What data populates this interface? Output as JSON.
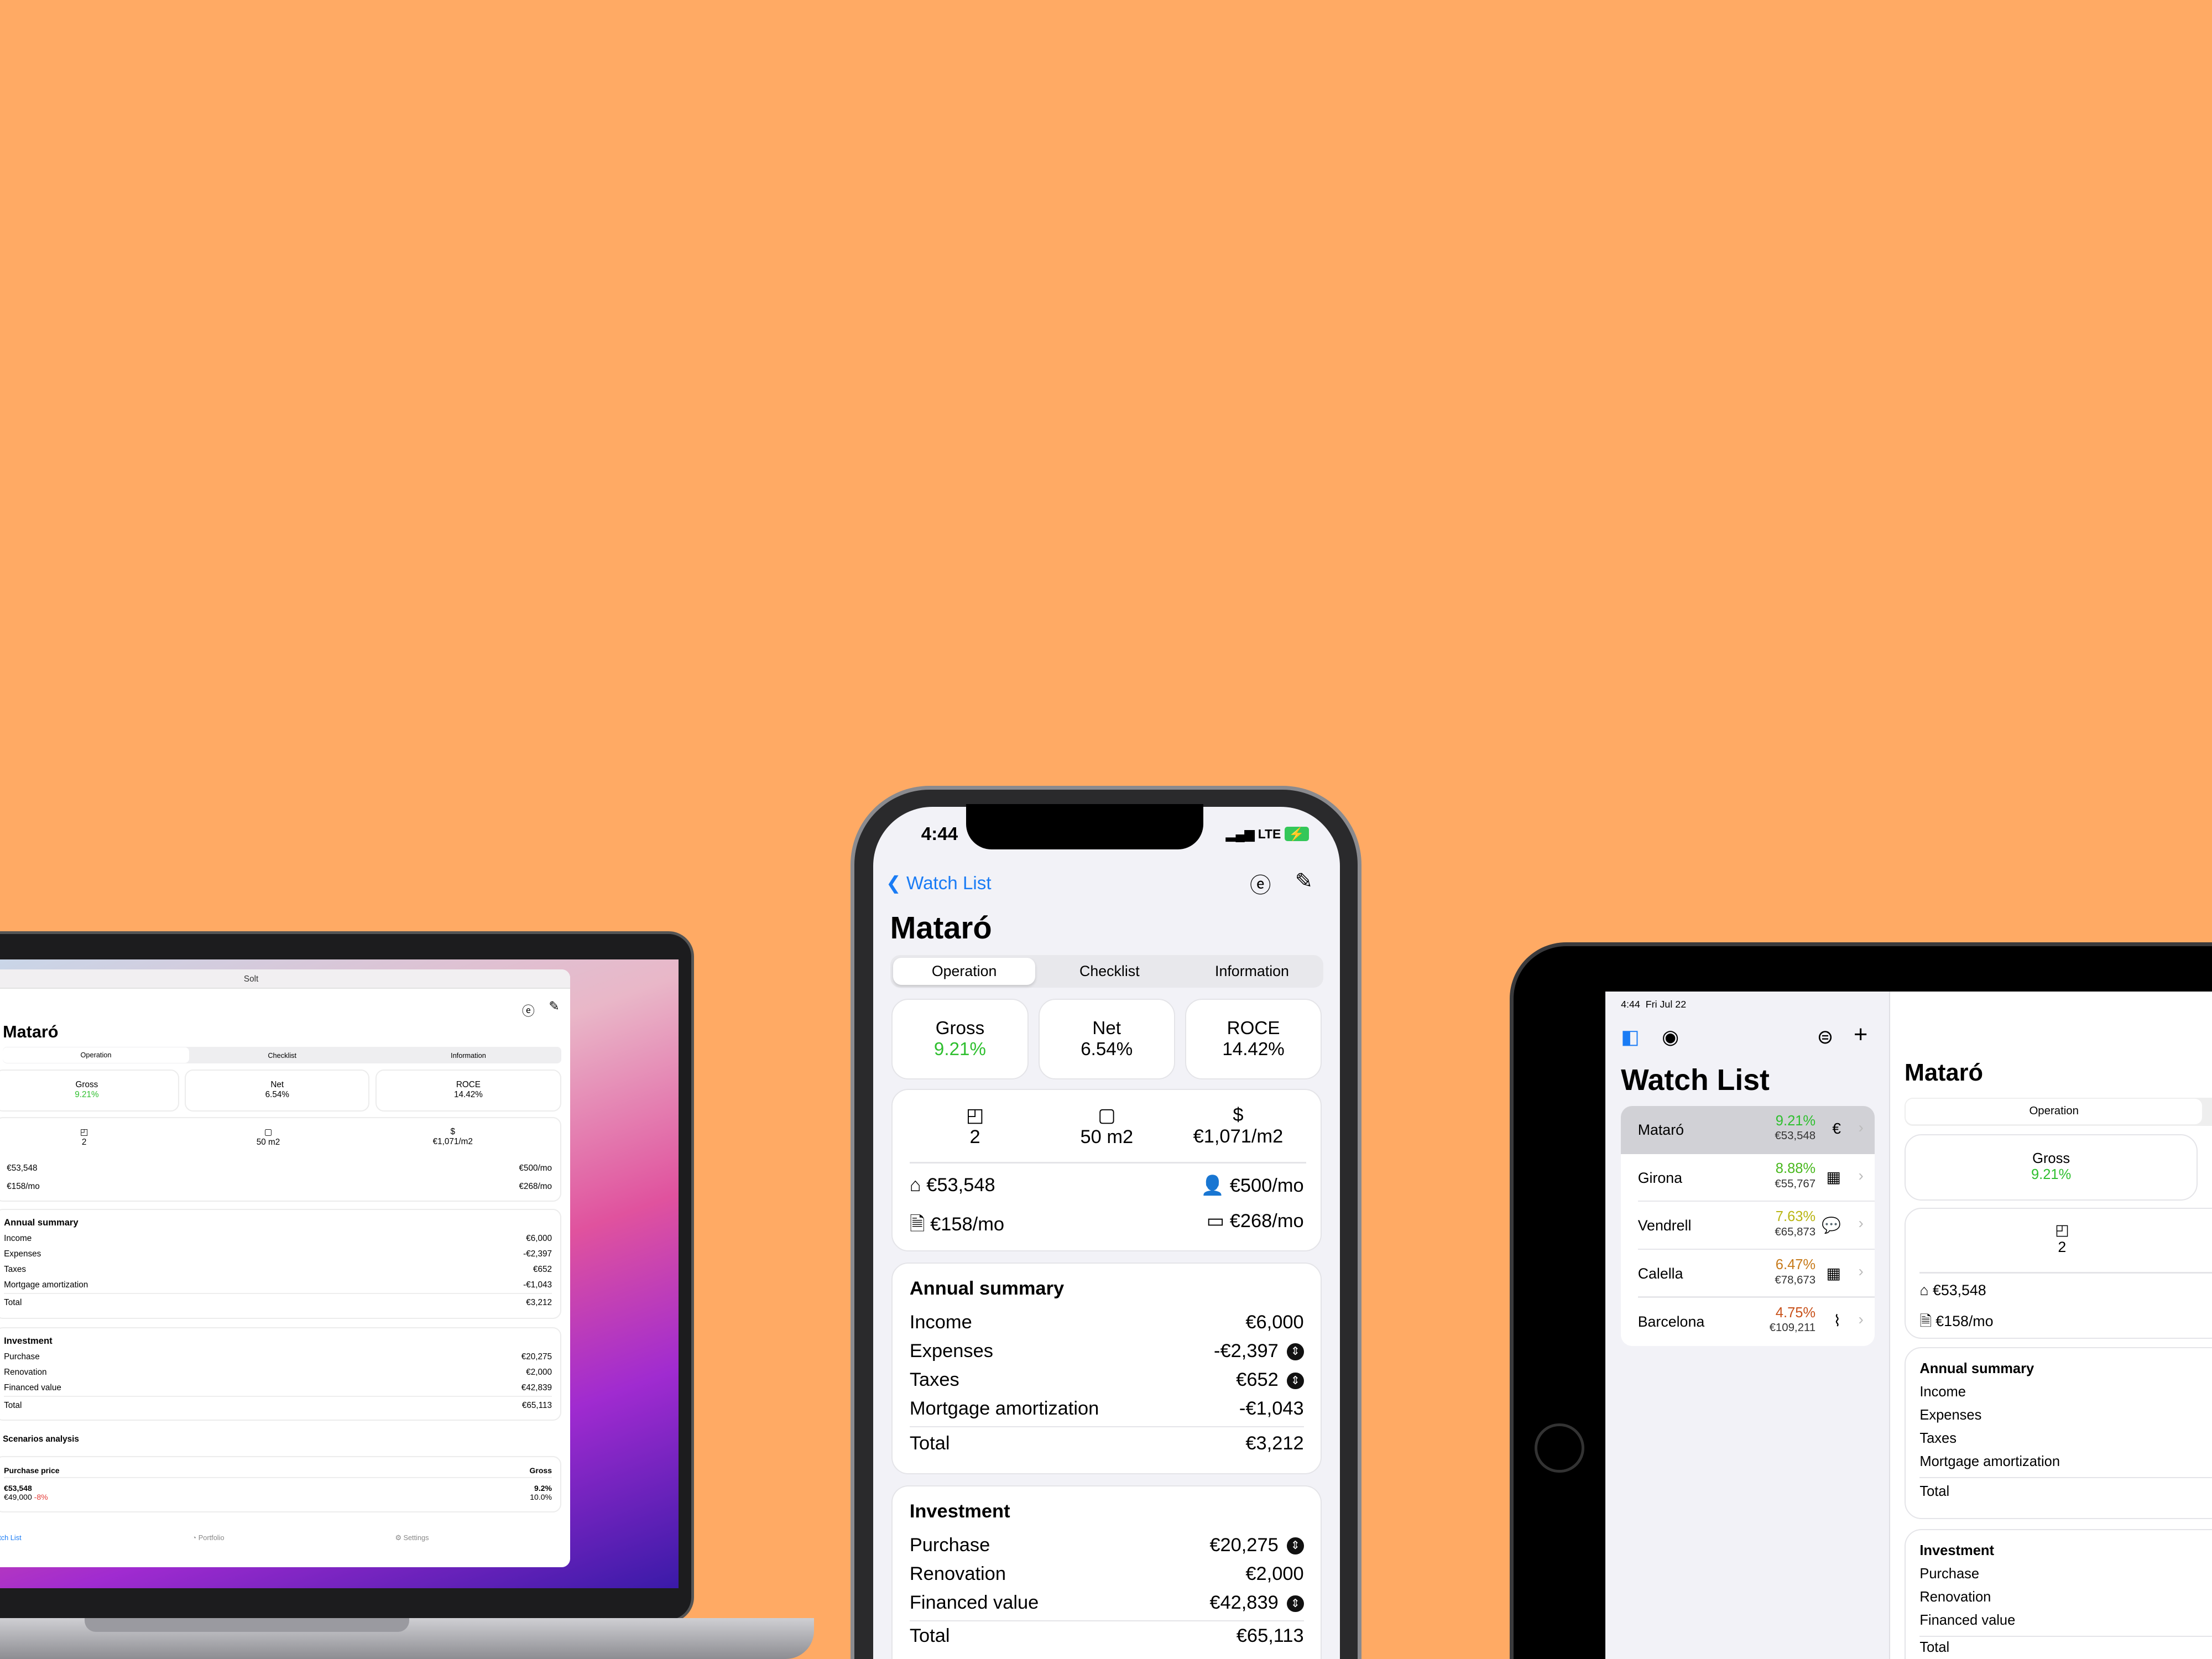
{
  "colors": {
    "background": "#FFAA64",
    "accent": "#1a7cf5",
    "positive": "#2fbf2f",
    "negative": "#e53935"
  },
  "laptop": {
    "window_title": "Solt",
    "title": "Mataró",
    "tabs": [
      "Operation",
      "Checklist",
      "Information"
    ],
    "metrics": [
      {
        "label": "Gross",
        "value": "9.21%"
      },
      {
        "label": "Net",
        "value": "6.54%"
      },
      {
        "label": "ROCE",
        "value": "14.42%"
      }
    ],
    "stats": [
      {
        "icon": "rooms-icon",
        "value": "2"
      },
      {
        "icon": "area-icon",
        "value": "50 m2"
      },
      {
        "icon": "price-per-m2-icon",
        "value": "€1,071/m2"
      }
    ],
    "price": "€53,548",
    "rent": "€500/mo",
    "fee": "€158/mo",
    "mortgage": "€268/mo",
    "annual": {
      "title": "Annual summary",
      "rows": [
        {
          "label": "Income",
          "value": "€6,000"
        },
        {
          "label": "Expenses",
          "value": "-€2,397"
        },
        {
          "label": "Taxes",
          "value": "€652"
        },
        {
          "label": "Mortgage amortization",
          "value": "-€1,043"
        }
      ],
      "total_label": "Total",
      "total": "€3,212"
    },
    "investment": {
      "title": "Investment",
      "rows": [
        {
          "label": "Purchase",
          "value": "€20,275"
        },
        {
          "label": "Renovation",
          "value": "€2,000"
        },
        {
          "label": "Financed value",
          "value": "€42,839"
        }
      ],
      "total_label": "Total",
      "total": "€65,113"
    },
    "scenarios": {
      "title": "Scenarios analysis",
      "col1": "Purchase price",
      "col2": "Gross",
      "row1_price": "€53,548",
      "row1_gross": "9.2%",
      "row2_price": "€49,000",
      "row2_delta": "-8%",
      "row2_gross": "10.0%"
    },
    "tabbar": [
      "Watch List",
      "Portfolio",
      "Settings"
    ]
  },
  "phone": {
    "time": "4:44",
    "network": "LTE",
    "back": "Watch List",
    "title": "Mataró",
    "tabs": [
      "Operation",
      "Checklist",
      "Information"
    ],
    "metrics": [
      {
        "label": "Gross",
        "value": "9.21%"
      },
      {
        "label": "Net",
        "value": "6.54%"
      },
      {
        "label": "ROCE",
        "value": "14.42%"
      }
    ],
    "stats": [
      {
        "value": "2"
      },
      {
        "value": "50 m2"
      },
      {
        "value": "€1,071/m2"
      }
    ],
    "price": "€53,548",
    "rent": "€500/mo",
    "fee": "€158/mo",
    "mortgage": "€268/mo",
    "annual": {
      "title": "Annual summary",
      "rows": [
        {
          "label": "Income",
          "value": "€6,000"
        },
        {
          "label": "Expenses",
          "value": "-€2,397"
        },
        {
          "label": "Taxes",
          "value": "€652"
        },
        {
          "label": "Mortgage amortization",
          "value": "-€1,043"
        }
      ],
      "total_label": "Total",
      "total": "€3,212"
    },
    "investment": {
      "title": "Investment",
      "rows": [
        {
          "label": "Purchase",
          "value": "€20,275"
        },
        {
          "label": "Renovation",
          "value": "€2,000"
        },
        {
          "label": "Financed value",
          "value": "€42,839"
        }
      ],
      "total_label": "Total",
      "total": "€65,113"
    }
  },
  "tablet": {
    "time": "4:44",
    "date": "Fri Jul 22",
    "list_title": "Watch List",
    "items": [
      {
        "name": "Mataró",
        "pct": "9.21%",
        "price": "€53,548",
        "color": "#2fbf2f",
        "icon": "€"
      },
      {
        "name": "Girona",
        "pct": "8.88%",
        "price": "€55,767",
        "color": "#49b81e",
        "icon": "▦"
      },
      {
        "name": "Vendrell",
        "pct": "7.63%",
        "price": "€65,873",
        "color": "#b9b514",
        "icon": "💬"
      },
      {
        "name": "Calella",
        "pct": "6.47%",
        "price": "€78,673",
        "color": "#c77a1a",
        "icon": "▦"
      },
      {
        "name": "Barcelona",
        "pct": "4.75%",
        "price": "€109,211",
        "color": "#c8511a",
        "icon": "⌇"
      }
    ],
    "detail": {
      "title": "Mataró",
      "tab": "Operation",
      "gross_label": "Gross",
      "gross": "9.21%",
      "rooms": "2",
      "price": "€53,548",
      "fee": "€158/mo",
      "annual_title": "Annual summary",
      "annual_rows": [
        "Income",
        "Expenses",
        "Taxes",
        "Mortgage amortization"
      ],
      "total_label": "Total",
      "investment_title": "Investment",
      "investment_rows": [
        "Purchase",
        "Renovation",
        "Financed value"
      ],
      "investment_total": "Total"
    }
  }
}
